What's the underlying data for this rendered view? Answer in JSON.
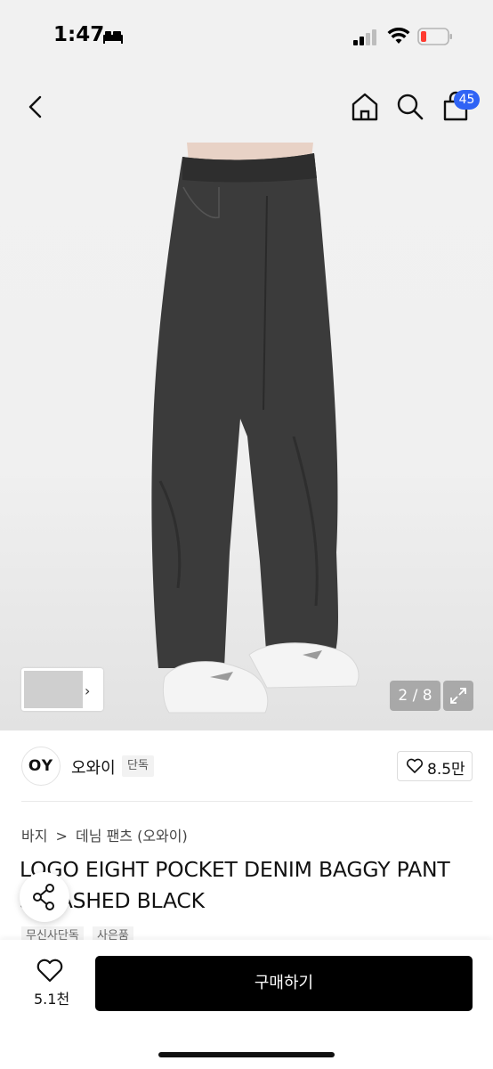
{
  "status_bar": {
    "time": "1:47"
  },
  "nav": {
    "cart_count": "45"
  },
  "gallery": {
    "page_indicator": "2 / 8"
  },
  "brand": {
    "logo_text": "OY",
    "name": "오와이",
    "tag": "단독",
    "likes": "8.5만"
  },
  "breadcrumb": {
    "category": "바지",
    "sep": ">",
    "subcategory": "데님 팬츠 (오와이)"
  },
  "product": {
    "title_line1": "LOGO EIGHT POCKET DENIM BAGGY PANT",
    "title_line2": "S WASHED BLACK",
    "badges": [
      "무신사단독",
      "사은품"
    ]
  },
  "bottom_bar": {
    "wish_count": "5.1천",
    "buy_label": "구매하기"
  },
  "colors": {
    "accent": "#2f63f5",
    "buy_button": "#000000"
  }
}
